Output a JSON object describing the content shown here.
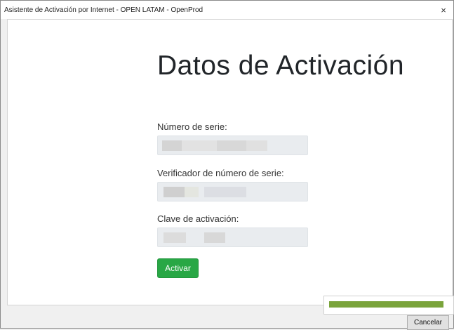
{
  "window": {
    "title": "Asistente de Activación por Internet - OPEN LATAM - OpenProd",
    "close_glyph": "×"
  },
  "form": {
    "heading": "Datos de Activación",
    "serial_label": "Número de serie:",
    "serial_value": "",
    "verifier_label": "Verificador de número de serie:",
    "verifier_value": "",
    "activation_key_label": "Clave de activación:",
    "activation_key_value": "",
    "activate_button": "Activar",
    "activate_button_color": "#28a745"
  },
  "footer": {
    "progress_fraction": 0.95,
    "progress_color": "#7aa43b",
    "cancel_button": "Cancelar"
  }
}
